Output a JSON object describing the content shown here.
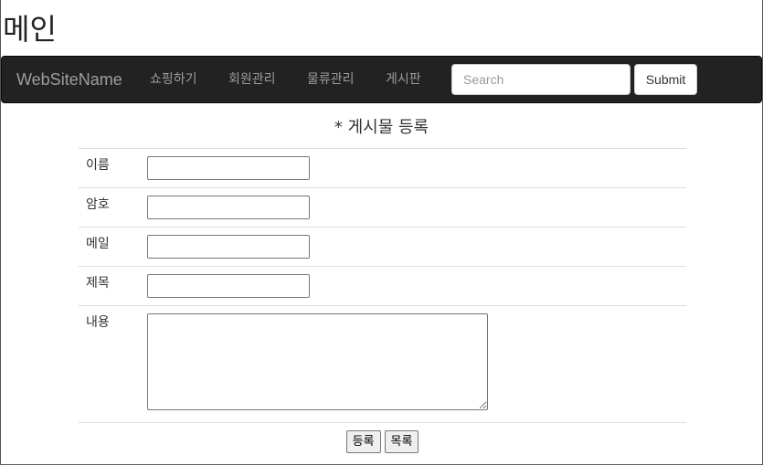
{
  "page": {
    "main_title": "메인"
  },
  "navbar": {
    "brand": "WebSiteName",
    "items": [
      {
        "label": "쇼핑하기"
      },
      {
        "label": "회원관리"
      },
      {
        "label": "물류관리"
      },
      {
        "label": "게시판"
      }
    ],
    "search": {
      "placeholder": "Search",
      "value": ""
    },
    "submit_label": "Submit"
  },
  "form": {
    "title": "* 게시물 등록",
    "fields": [
      {
        "label": "이름",
        "value": ""
      },
      {
        "label": "암호",
        "value": ""
      },
      {
        "label": "메일",
        "value": ""
      },
      {
        "label": "제목",
        "value": ""
      },
      {
        "label": "내용",
        "value": ""
      }
    ],
    "register_label": "등록",
    "list_label": "목록"
  },
  "colors": {
    "navbar_bg": "#222222",
    "nav_text": "#9d9d9d",
    "divider": "#dddddd"
  }
}
